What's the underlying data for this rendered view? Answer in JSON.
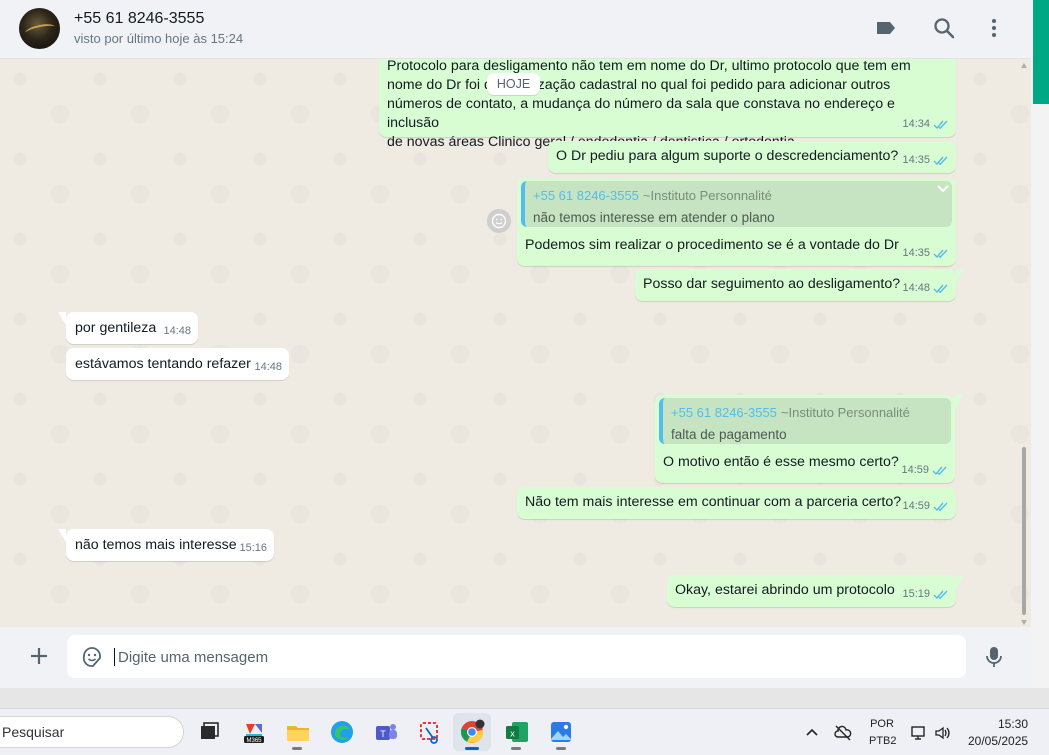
{
  "header": {
    "contact_name": "+55 61 8246-3555",
    "contact_status": "visto por último hoje às 15:24",
    "icons": [
      "label-icon",
      "search-icon",
      "menu-icon"
    ]
  },
  "date_badge": "HOJE",
  "messages": [
    {
      "id": "m1",
      "direction": "out",
      "lines": [
        "Protocolo para desligamento não tem em nome do Dr, ultimo protocolo que tem em",
        "nome do Dr foi de atualização cadastral no qual foi pedido para adicionar outros",
        "números de contato, a mudança do número da sala que constava no endereço e inclusão",
        "de novas áreas Clinico geral / endodontia /  dentistica / ortodontia"
      ],
      "time": "14:34",
      "read": true
    },
    {
      "id": "m2",
      "direction": "out",
      "text": "O Dr pediu para algum suporte o descredenciamento?",
      "time": "14:35",
      "read": true
    },
    {
      "id": "m3",
      "direction": "out",
      "quote": {
        "name": "+55 61 8246-3555",
        "group": "~Instituto Personnalité",
        "text": "não temos interesse em atender o plano"
      },
      "text": "Podemos sim realizar o procedimento se é a vontade do Dr",
      "time": "14:35",
      "read": true
    },
    {
      "id": "m4",
      "direction": "out",
      "text": "Posso dar seguimento ao desligamento?",
      "time": "14:48",
      "read": true
    },
    {
      "id": "m5",
      "direction": "in",
      "text": "por gentileza",
      "time": "14:48"
    },
    {
      "id": "m6",
      "direction": "in",
      "text": "estávamos tentando refazer",
      "time": "14:48"
    },
    {
      "id": "m7",
      "direction": "out",
      "quote": {
        "name": "+55 61 8246-3555",
        "group": "~Instituto Personnalité",
        "text": "falta de pagamento"
      },
      "text": "O motivo então é esse mesmo certo?",
      "time": "14:59",
      "read": true
    },
    {
      "id": "m8",
      "direction": "out",
      "text": "Não tem mais interesse em continuar com a parceria certo?",
      "time": "14:59",
      "read": true
    },
    {
      "id": "m9",
      "direction": "in",
      "text": "não temos mais interesse",
      "time": "15:16"
    },
    {
      "id": "m10",
      "direction": "out",
      "text": "Okay, estarei abrindo um protocolo",
      "time": "15:19",
      "read": true
    }
  ],
  "composer": {
    "placeholder": "Digite uma mensagem",
    "value": ""
  },
  "taskbar": {
    "search_label": "Pesquisar",
    "apps": [
      "task-view-icon",
      "microsoft-365-icon",
      "file-explorer-icon",
      "edge-icon",
      "teams-icon",
      "snipping-tool-icon",
      "chrome-icon",
      "excel-icon",
      "photos-icon"
    ],
    "m365_label": "M365",
    "lang_top": "POR",
    "lang_bottom": "PTB2",
    "time": "15:30",
    "date": "20/05/2025"
  },
  "colors": {
    "outgoing_bubble": "#d9fdd3",
    "incoming_bubble": "#ffffff",
    "quote_accent": "#53bdeb",
    "read_ticks": "#53bdeb",
    "accent_green": "#00a884"
  }
}
